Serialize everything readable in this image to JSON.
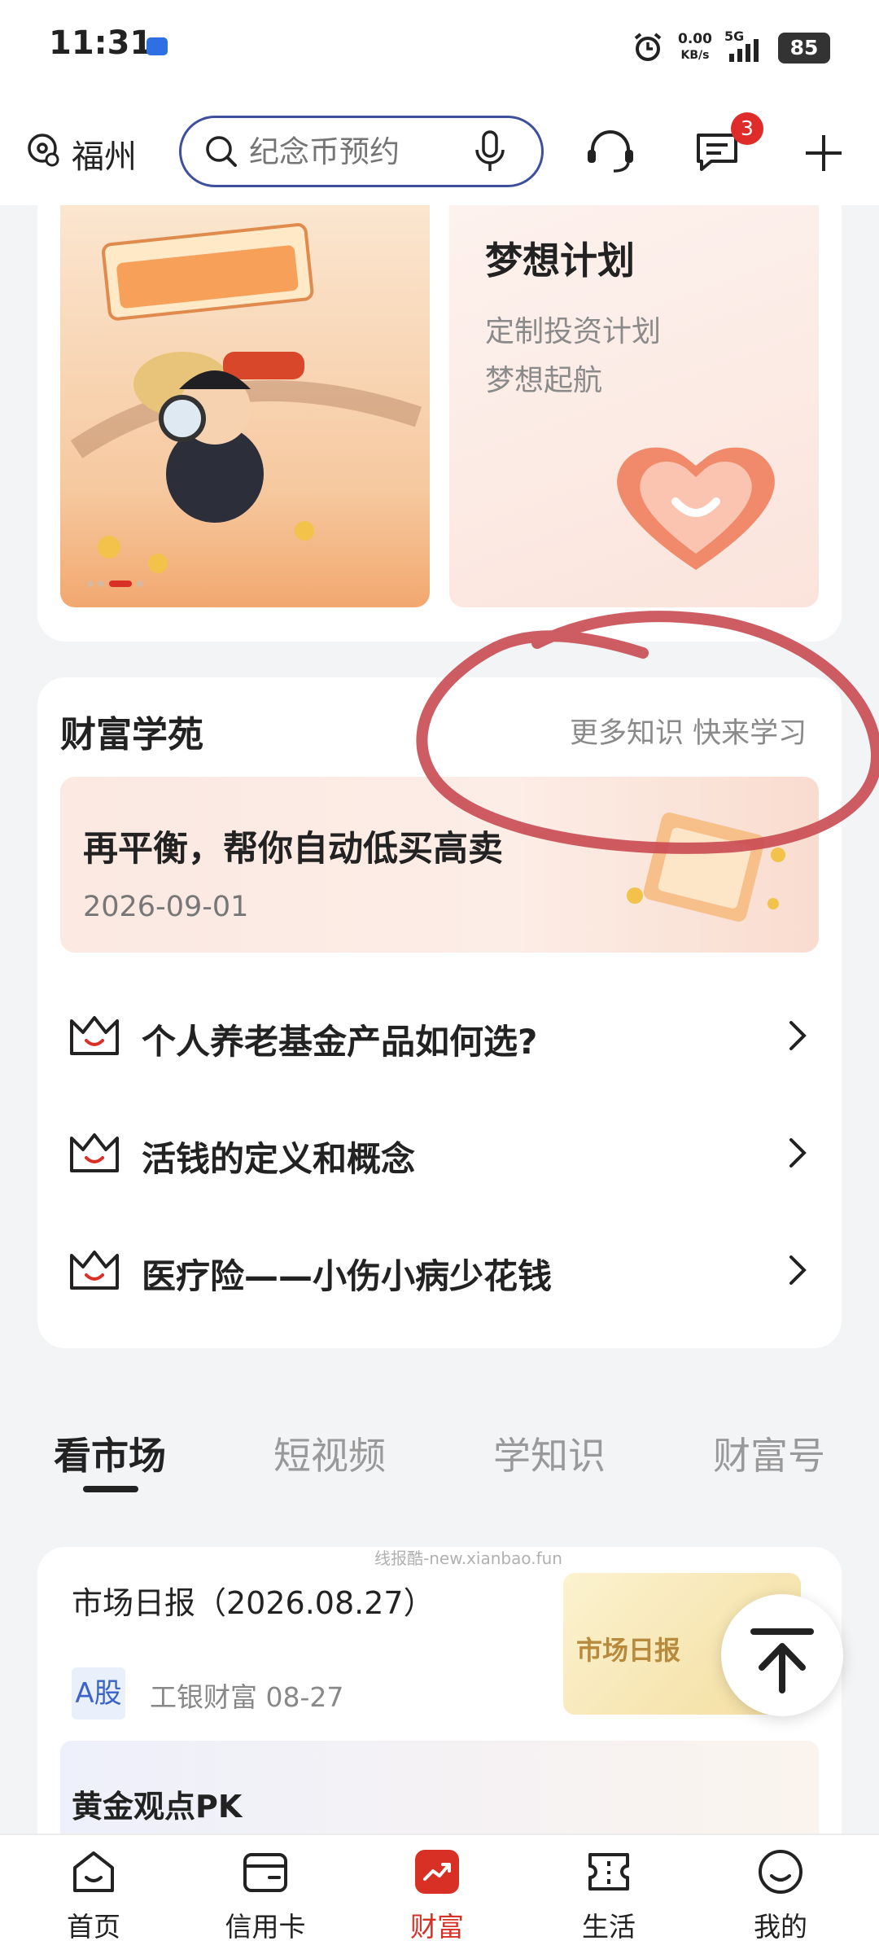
{
  "status_bar": {
    "time": "11:31",
    "net_speed_value": "0.00",
    "net_speed_unit": "KB/s",
    "network": "5G",
    "battery": "85"
  },
  "header": {
    "city": "福州",
    "search_placeholder": "纪念币预约",
    "message_badge": "3",
    "icons": [
      "location-icon",
      "search-icon",
      "mic-icon",
      "customer-service-icon",
      "message-icon",
      "plus-icon"
    ]
  },
  "top_cards": {
    "dream_title": "梦想计划",
    "dream_line1": "定制投资计划",
    "dream_line2": "梦想起航"
  },
  "academy": {
    "title": "财富学苑",
    "more": "更多知识 快来学习",
    "feature_title": "再平衡，帮你自动低买高卖",
    "feature_date": "2026-09-01",
    "articles": [
      "个人养老基金产品如何选?",
      "活钱的定义和概念",
      "医疗险——小伤小病少花钱"
    ]
  },
  "tabs": [
    "看市场",
    "短视频",
    "学知识",
    "财富号"
  ],
  "market": {
    "watermark": "线报酷-new.xianbao.fun",
    "title": "市场日报（2026.08.27）",
    "tag": "A股",
    "source": "工银财富  08-27",
    "thumb_text": "市场日报",
    "next_title": "黄金观点PK"
  },
  "bottom_nav": [
    {
      "label": "首页",
      "icon": "home-icon"
    },
    {
      "label": "信用卡",
      "icon": "credit-card-icon"
    },
    {
      "label": "财富",
      "icon": "wealth-icon"
    },
    {
      "label": "生活",
      "icon": "life-ticket-icon"
    },
    {
      "label": "我的",
      "icon": "profile-icon"
    }
  ],
  "colors": {
    "accent_red": "#d93026",
    "search_border": "#3e4f9c",
    "annotation": "#c94a52"
  }
}
